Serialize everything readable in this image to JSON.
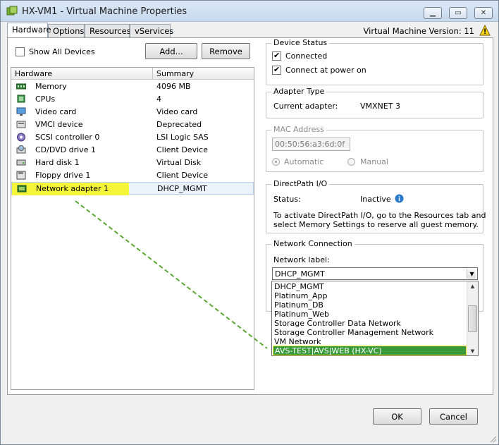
{
  "window": {
    "title": "HX-VM1 - Virtual Machine Properties",
    "icon": "vm-icon",
    "controls": [
      "minimize-icon",
      "maximize-icon",
      "close-icon"
    ]
  },
  "tabs": [
    {
      "label": "Hardware",
      "active": true
    },
    {
      "label": "Options",
      "active": false
    },
    {
      "label": "Resources",
      "active": false
    },
    {
      "label": "vServices",
      "active": false
    }
  ],
  "vm_version": "Virtual Machine Version: 11",
  "left": {
    "show_all_devices": {
      "label": "Show All Devices",
      "checked": false
    },
    "add_button": "Add...",
    "remove_button": "Remove",
    "columns": {
      "hardware": "Hardware",
      "summary": "Summary"
    },
    "devices": [
      {
        "name": "Memory",
        "summary": "4096 MB",
        "icon": "memory-icon"
      },
      {
        "name": "CPUs",
        "summary": "4",
        "icon": "cpu-icon"
      },
      {
        "name": "Video card",
        "summary": "Video card",
        "icon": "monitor-icon"
      },
      {
        "name": "VMCI device",
        "summary": "Deprecated",
        "icon": "vmci-icon"
      },
      {
        "name": "SCSI controller 0",
        "summary": "LSI Logic SAS",
        "icon": "scsi-icon"
      },
      {
        "name": "CD/DVD drive 1",
        "summary": "Client Device",
        "icon": "cdrom-icon"
      },
      {
        "name": "Hard disk 1",
        "summary": "Virtual Disk",
        "icon": "harddisk-icon"
      },
      {
        "name": "Floppy drive 1",
        "summary": "Client Device",
        "icon": "floppy-icon"
      },
      {
        "name": "Network adapter 1",
        "summary": "DHCP_MGMT",
        "icon": "network-adapter-icon",
        "selected": true
      }
    ]
  },
  "device_status": {
    "title": "Device Status",
    "connected": {
      "label": "Connected",
      "checked": true
    },
    "connect_at_power_on": {
      "label": "Connect at power on",
      "checked": true
    }
  },
  "adapter_type": {
    "title": "Adapter Type",
    "current_label": "Current adapter:",
    "current_value": "VMXNET 3"
  },
  "mac_address": {
    "title": "MAC Address",
    "value": "00:50:56:a3:6d:0f",
    "automatic": "Automatic",
    "manual": "Manual"
  },
  "directpath": {
    "title": "DirectPath I/O",
    "status_label": "Status:",
    "status_value": "Inactive",
    "note_line1": "To activate DirectPath I/O, go to the Resources tab and",
    "note_line2": "select Memory Settings to reserve all guest memory."
  },
  "network_connection": {
    "title": "Network Connection",
    "label": "Network label:",
    "selected": "DHCP_MGMT",
    "options": [
      "DHCP_MGMT",
      "Platinum_App",
      "Platinum_DB",
      "Platinum_Web",
      "Storage Controller Data Network",
      "Storage Controller Management Network",
      "VM Network",
      "AVS-TEST|AVS|WEB (HX-VC)"
    ],
    "highlighted": "AVS-TEST|AVS|WEB (HX-VC)"
  },
  "footer": {
    "ok": "OK",
    "cancel": "Cancel"
  },
  "colors": {
    "highlight_yellow": "#f5f53a",
    "annotation_green": "#5aa832",
    "selected_option": "#3a9a3a"
  }
}
